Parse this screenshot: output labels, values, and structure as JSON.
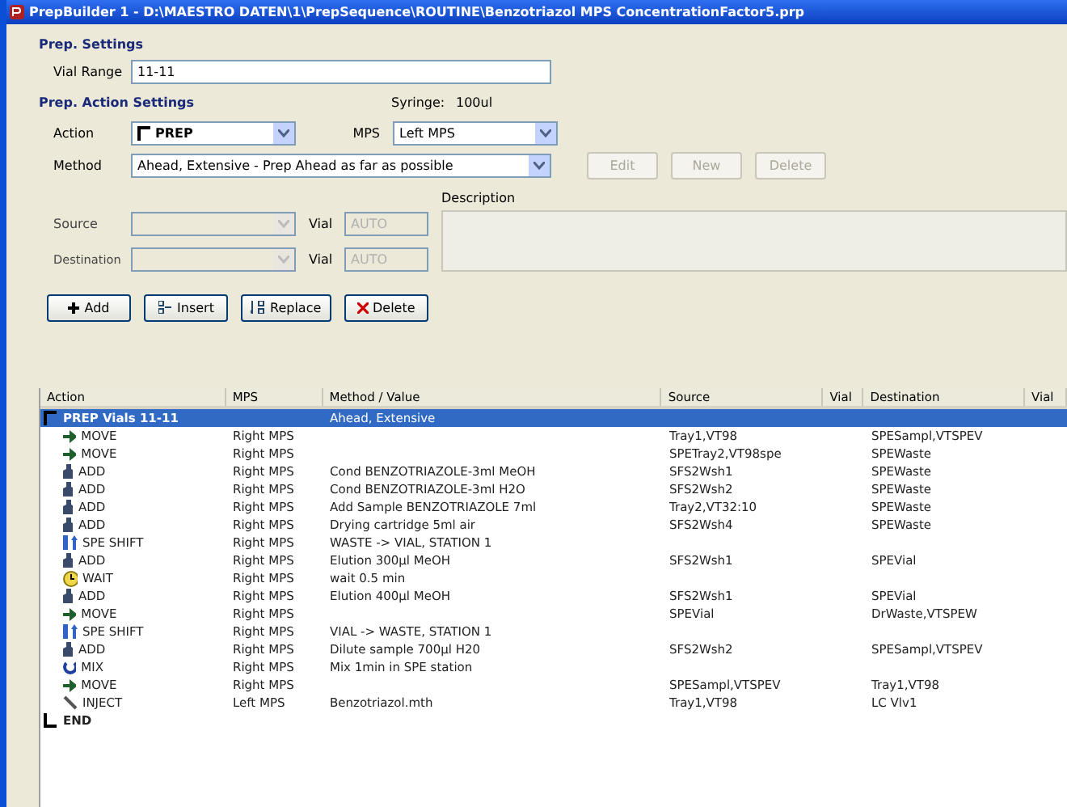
{
  "window": {
    "title": "PrepBuilder 1 - D:\\MAESTRO DATEN\\1\\PrepSequence\\ROUTINE\\Benzotriazol MPS ConcentrationFactor5.prp"
  },
  "prep_settings": {
    "heading": "Prep. Settings",
    "vial_range_label": "Vial Range",
    "vial_range": "11-11"
  },
  "action_settings": {
    "heading": "Prep. Action Settings",
    "syringe_label": "Syringe:",
    "syringe": "100ul",
    "action_label": "Action",
    "action": "PREP",
    "mps_label": "MPS",
    "mps": "Left MPS",
    "method_label": "Method",
    "method": "Ahead, Extensive - Prep Ahead as far as possible",
    "method_buttons": [
      {
        "label": "Edit",
        "disabled": true
      },
      {
        "label": "New",
        "disabled": true
      },
      {
        "label": "Delete",
        "disabled": true
      }
    ],
    "description_label": "Description",
    "source_label": "Source",
    "source_disabled": true,
    "source_vial_label": "Vial",
    "source_vial": "AUTO",
    "destination_label": "Destination",
    "destination_disabled": true,
    "destination_vial_label": "Vial",
    "destination_vial": "AUTO"
  },
  "buttons": [
    {
      "label": "Add",
      "kind": "add"
    },
    {
      "label": "Insert",
      "kind": "insert"
    },
    {
      "label": "Replace",
      "kind": "replace"
    },
    {
      "label": "Delete",
      "kind": "delete"
    }
  ],
  "table": {
    "columns": [
      "Action",
      "MPS",
      "Method / Value",
      "Source",
      "Vial",
      "Destination",
      "Vial"
    ],
    "rows": [
      {
        "kind": "prep",
        "action": "PREP Vials 11-11",
        "mps": "",
        "method": "Ahead, Extensive",
        "source": "",
        "destination": "",
        "selected": true
      },
      {
        "kind": "move",
        "action": "MOVE",
        "mps": "Right MPS",
        "method": "",
        "source": "Tray1,VT98",
        "destination": "SPESampl,VTSPEV",
        "selected": false
      },
      {
        "kind": "move",
        "action": "MOVE",
        "mps": "Right MPS",
        "method": "",
        "source": "SPETray2,VT98spe",
        "destination": "SPEWaste",
        "selected": false
      },
      {
        "kind": "add",
        "action": "ADD",
        "mps": "Right MPS",
        "method": "Cond BENZOTRIAZOLE-3ml MeOH",
        "source": "SFS2Wsh1",
        "destination": "SPEWaste",
        "selected": false
      },
      {
        "kind": "add",
        "action": "ADD",
        "mps": "Right MPS",
        "method": "Cond BENZOTRIAZOLE-3ml H2O",
        "source": "SFS2Wsh2",
        "destination": "SPEWaste",
        "selected": false
      },
      {
        "kind": "add",
        "action": "ADD",
        "mps": "Right MPS",
        "method": "Add Sample BENZOTRIAZOLE 7ml",
        "source": "Tray2,VT32:10",
        "destination": "SPEWaste",
        "selected": false
      },
      {
        "kind": "add",
        "action": "ADD",
        "mps": "Right MPS",
        "method": "Drying cartridge 5ml air",
        "source": "SFS2Wsh4",
        "destination": "SPEWaste",
        "selected": false
      },
      {
        "kind": "shift",
        "action": "SPE SHIFT",
        "mps": "Right MPS",
        "method": "WASTE -> VIAL, STATION 1",
        "source": "",
        "destination": "",
        "selected": false
      },
      {
        "kind": "add",
        "action": "ADD",
        "mps": "Right MPS",
        "method": "Elution 300µl MeOH",
        "source": "SFS2Wsh1",
        "destination": "SPEVial",
        "selected": false
      },
      {
        "kind": "wait",
        "action": "WAIT",
        "mps": "Right MPS",
        "method": "wait 0.5 min",
        "source": "",
        "destination": "",
        "selected": false
      },
      {
        "kind": "add",
        "action": "ADD",
        "mps": "Right MPS",
        "method": "Elution 400µl MeOH",
        "source": "SFS2Wsh1",
        "destination": "SPEVial",
        "selected": false
      },
      {
        "kind": "move",
        "action": "MOVE",
        "mps": "Right MPS",
        "method": "",
        "source": "SPEVial",
        "destination": "DrWaste,VTSPEW",
        "selected": false
      },
      {
        "kind": "shift",
        "action": "SPE SHIFT",
        "mps": "Right MPS",
        "method": "VIAL -> WASTE, STATION 1",
        "source": "",
        "destination": "",
        "selected": false
      },
      {
        "kind": "add",
        "action": "ADD",
        "mps": "Right MPS",
        "method": "Dilute sample 700µl H20",
        "source": "SFS2Wsh2",
        "destination": "SPESampl,VTSPEV",
        "selected": false
      },
      {
        "kind": "mix",
        "action": "MIX",
        "mps": "Right MPS",
        "method": "Mix 1min in SPE station",
        "source": "",
        "destination": "",
        "selected": false
      },
      {
        "kind": "move",
        "action": "MOVE",
        "mps": "Right MPS",
        "method": "",
        "source": "SPESampl,VTSPEV",
        "destination": "Tray1,VT98",
        "selected": false
      },
      {
        "kind": "inject",
        "action": "INJECT",
        "mps": "Left MPS",
        "method": "Benzotriazol.mth",
        "source": "Tray1,VT98",
        "destination": "LC Vlv1",
        "selected": false
      },
      {
        "kind": "end",
        "action": "END",
        "mps": "",
        "method": "",
        "source": "",
        "destination": "",
        "selected": false
      }
    ]
  }
}
